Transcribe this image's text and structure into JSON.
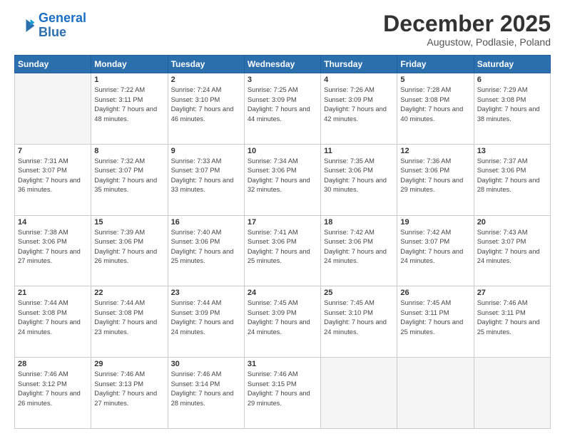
{
  "logo": {
    "line1": "General",
    "line2": "Blue"
  },
  "title": "December 2025",
  "location": "Augustow, Podlasie, Poland",
  "days_of_week": [
    "Sunday",
    "Monday",
    "Tuesday",
    "Wednesday",
    "Thursday",
    "Friday",
    "Saturday"
  ],
  "weeks": [
    [
      {
        "day": "",
        "empty": true
      },
      {
        "day": "1",
        "sunrise": "7:22 AM",
        "sunset": "3:11 PM",
        "daylight": "7 hours and 48 minutes."
      },
      {
        "day": "2",
        "sunrise": "7:24 AM",
        "sunset": "3:10 PM",
        "daylight": "7 hours and 46 minutes."
      },
      {
        "day": "3",
        "sunrise": "7:25 AM",
        "sunset": "3:09 PM",
        "daylight": "7 hours and 44 minutes."
      },
      {
        "day": "4",
        "sunrise": "7:26 AM",
        "sunset": "3:09 PM",
        "daylight": "7 hours and 42 minutes."
      },
      {
        "day": "5",
        "sunrise": "7:28 AM",
        "sunset": "3:08 PM",
        "daylight": "7 hours and 40 minutes."
      },
      {
        "day": "6",
        "sunrise": "7:29 AM",
        "sunset": "3:08 PM",
        "daylight": "7 hours and 38 minutes."
      }
    ],
    [
      {
        "day": "7",
        "sunrise": "7:31 AM",
        "sunset": "3:07 PM",
        "daylight": "7 hours and 36 minutes."
      },
      {
        "day": "8",
        "sunrise": "7:32 AM",
        "sunset": "3:07 PM",
        "daylight": "7 hours and 35 minutes."
      },
      {
        "day": "9",
        "sunrise": "7:33 AM",
        "sunset": "3:07 PM",
        "daylight": "7 hours and 33 minutes."
      },
      {
        "day": "10",
        "sunrise": "7:34 AM",
        "sunset": "3:06 PM",
        "daylight": "7 hours and 32 minutes."
      },
      {
        "day": "11",
        "sunrise": "7:35 AM",
        "sunset": "3:06 PM",
        "daylight": "7 hours and 30 minutes."
      },
      {
        "day": "12",
        "sunrise": "7:36 AM",
        "sunset": "3:06 PM",
        "daylight": "7 hours and 29 minutes."
      },
      {
        "day": "13",
        "sunrise": "7:37 AM",
        "sunset": "3:06 PM",
        "daylight": "7 hours and 28 minutes."
      }
    ],
    [
      {
        "day": "14",
        "sunrise": "7:38 AM",
        "sunset": "3:06 PM",
        "daylight": "7 hours and 27 minutes."
      },
      {
        "day": "15",
        "sunrise": "7:39 AM",
        "sunset": "3:06 PM",
        "daylight": "7 hours and 26 minutes."
      },
      {
        "day": "16",
        "sunrise": "7:40 AM",
        "sunset": "3:06 PM",
        "daylight": "7 hours and 25 minutes."
      },
      {
        "day": "17",
        "sunrise": "7:41 AM",
        "sunset": "3:06 PM",
        "daylight": "7 hours and 25 minutes."
      },
      {
        "day": "18",
        "sunrise": "7:42 AM",
        "sunset": "3:06 PM",
        "daylight": "7 hours and 24 minutes."
      },
      {
        "day": "19",
        "sunrise": "7:42 AM",
        "sunset": "3:07 PM",
        "daylight": "7 hours and 24 minutes."
      },
      {
        "day": "20",
        "sunrise": "7:43 AM",
        "sunset": "3:07 PM",
        "daylight": "7 hours and 24 minutes."
      }
    ],
    [
      {
        "day": "21",
        "sunrise": "7:44 AM",
        "sunset": "3:08 PM",
        "daylight": "7 hours and 24 minutes."
      },
      {
        "day": "22",
        "sunrise": "7:44 AM",
        "sunset": "3:08 PM",
        "daylight": "7 hours and 23 minutes."
      },
      {
        "day": "23",
        "sunrise": "7:44 AM",
        "sunset": "3:09 PM",
        "daylight": "7 hours and 24 minutes."
      },
      {
        "day": "24",
        "sunrise": "7:45 AM",
        "sunset": "3:09 PM",
        "daylight": "7 hours and 24 minutes."
      },
      {
        "day": "25",
        "sunrise": "7:45 AM",
        "sunset": "3:10 PM",
        "daylight": "7 hours and 24 minutes."
      },
      {
        "day": "26",
        "sunrise": "7:45 AM",
        "sunset": "3:11 PM",
        "daylight": "7 hours and 25 minutes."
      },
      {
        "day": "27",
        "sunrise": "7:46 AM",
        "sunset": "3:11 PM",
        "daylight": "7 hours and 25 minutes."
      }
    ],
    [
      {
        "day": "28",
        "sunrise": "7:46 AM",
        "sunset": "3:12 PM",
        "daylight": "7 hours and 26 minutes."
      },
      {
        "day": "29",
        "sunrise": "7:46 AM",
        "sunset": "3:13 PM",
        "daylight": "7 hours and 27 minutes."
      },
      {
        "day": "30",
        "sunrise": "7:46 AM",
        "sunset": "3:14 PM",
        "daylight": "7 hours and 28 minutes."
      },
      {
        "day": "31",
        "sunrise": "7:46 AM",
        "sunset": "3:15 PM",
        "daylight": "7 hours and 29 minutes."
      },
      {
        "day": "",
        "empty": true
      },
      {
        "day": "",
        "empty": true
      },
      {
        "day": "",
        "empty": true
      }
    ]
  ]
}
